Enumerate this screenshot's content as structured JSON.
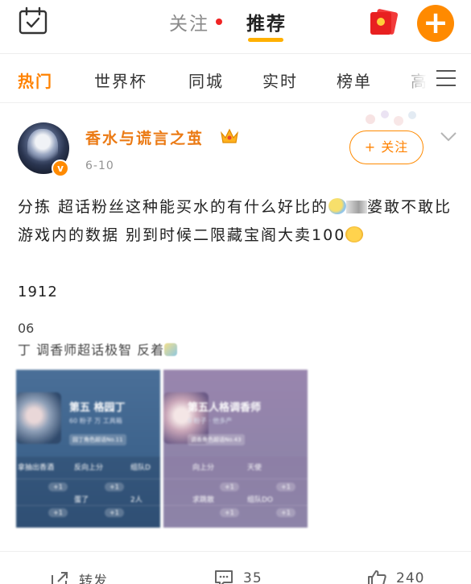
{
  "top_tabs": {
    "following": "关注",
    "recommended": "推荐"
  },
  "channels": [
    "热门",
    "世界杯",
    "同城",
    "实时",
    "榜单",
    "高"
  ],
  "post": {
    "username": "香水与谎言之茧",
    "date": "6-10",
    "follow_label": "+ 关注",
    "text_part1": "分拣 超话粉丝这种能买水的有什么好比的",
    "text_part2": "婆敢不敢比游戏内的数据 别到时候二限藏宝阁大卖100",
    "line2": "1912",
    "line3": "06",
    "line4": "丁 调香师超话极智 反着",
    "images": [
      {
        "title": "第五 格园丁",
        "sub": "60 粉子 万 工具箱",
        "tag": "园丁角色超话No.11",
        "cells": [
          "拿抽出香酒",
          "反向上分",
          "组队D",
          "",
          "",
          "蛋了",
          "2人",
          ""
        ]
      },
      {
        "title": "第五人格调香师",
        "sub": "9 粉子 · 他多产",
        "tag": "调香角色超话No.43",
        "cells": [
          "向上分",
          "天使",
          "",
          "求跳散",
          "组队DO",
          ""
        ]
      }
    ]
  },
  "actions": {
    "repost": "转发",
    "comments": "35",
    "likes": "240"
  },
  "colors": {
    "accent": "#ff8200",
    "brand_orange": "#ff8a00",
    "tab_underline": "#ffb000",
    "red_dot": "#f02424"
  }
}
